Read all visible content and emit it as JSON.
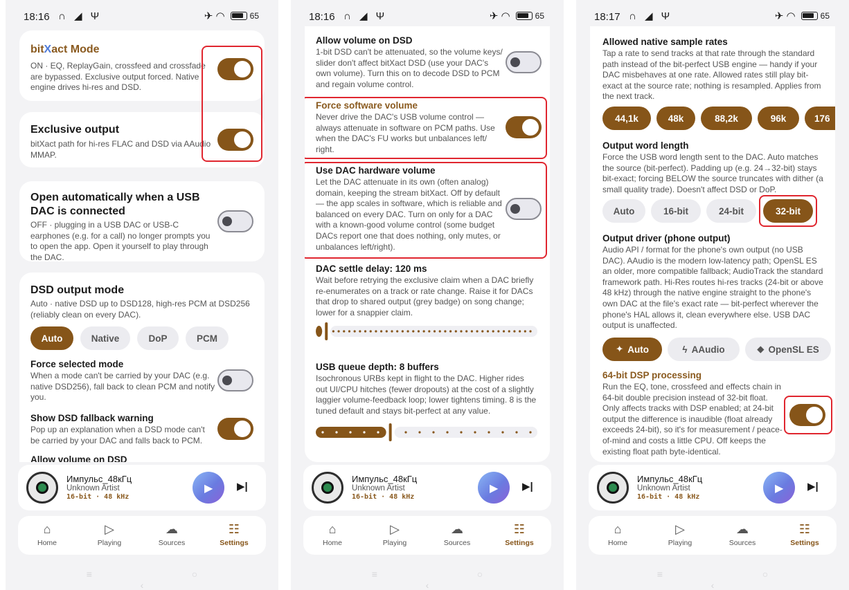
{
  "panel1": {
    "status": {
      "time": "18:16",
      "left_glyphs": "∩ ◢ Ψ",
      "right_glyphs": "✈ ◠",
      "battery": "65"
    },
    "bitxact": {
      "title_a": "bit",
      "title_x": "X",
      "title_b": "act Mode",
      "desc": "ON · EQ, ReplayGain, crossfeed and crossfade are bypassed. Exclusive output forced. Native engine drives hi-res and DSD."
    },
    "exclusive": {
      "title": "Exclusive output",
      "desc": "bitXact path for hi-res FLAC and DSD via AAudio MMAP."
    },
    "openauto": {
      "title": "Open automatically when a USB DAC is connected",
      "desc": "OFF · plugging in a USB DAC or USB-C earphones (e.g. for a call) no longer prompts you to open the app. Open it yourself to play through the DAC."
    },
    "dsd": {
      "title": "DSD output mode",
      "desc": "Auto · native DSD up to DSD128, high-res PCM at DSD256 (reliably clean on every DAC).",
      "chips": [
        "Auto",
        "Native",
        "DoP",
        "PCM"
      ],
      "selected": "Auto"
    },
    "force": {
      "title": "Force selected mode",
      "desc": "When a mode can't be carried by your DAC (e.g. native DSD256), fall back to clean PCM and notify you."
    },
    "warn": {
      "title": "Show DSD fallback warning",
      "desc": "Pop up an explanation when a DSD mode can't be carried by your DAC and falls back to PCM."
    },
    "cut": "Allow volume on DSD"
  },
  "panel2": {
    "status": {
      "time": "18:16",
      "left_glyphs": "∩ ◢ Ψ",
      "right_glyphs": "✈ ◠",
      "battery": "65"
    },
    "allowvol": {
      "title": "Allow volume on DSD",
      "desc": "1-bit DSD can't be attenuated, so the volume keys/ slider don't affect bitXact DSD (use your DAC's own volume). Turn this on to decode DSD to PCM and regain volume control."
    },
    "forcesw": {
      "title": "Force software volume",
      "desc": "Never drive the DAC's USB volume control — always attenuate in software on PCM paths. Use when the DAC's FU works but unbalances left/ right."
    },
    "dachw": {
      "title": "Use DAC hardware volume",
      "desc": "Let the DAC attenuate in its own (often analog) domain, keeping the stream bitXact. Off by default — the app scales in software, which is reliable and balanced on every DAC. Turn on only for a DAC with a known-good volume control (some budget DACs report one that does nothing, only mutes, or unbalances left/right)."
    },
    "settle": {
      "title": "DAC settle delay: 120 ms",
      "desc": "Wait before retrying the exclusive claim when a DAC briefly re-enumerates on a track or rate change. Raise it for DACs that drop to shared output (grey badge) on song change; lower for a snappier claim.",
      "value_fraction": 0.03
    },
    "queue": {
      "title": "USB queue depth: 8 buffers",
      "desc": "Isochronous URBs kept in flight to the DAC. Higher rides out UI/CPU hitches (fewer dropouts) at the cost of a slightly laggier volume-feedback loop; lower tightens timing. 8 is the tuned default and stays bit-perfect at any value.",
      "value_fraction": 0.33
    }
  },
  "panel3": {
    "status": {
      "time": "18:17",
      "left_glyphs": "∩ ◢ Ψ",
      "right_glyphs": "✈ ◠",
      "battery": "65"
    },
    "rates": {
      "title": "Allowed native sample rates",
      "desc": "Tap a rate to send tracks at that rate through the standard path instead of the bit-perfect USB engine — handy if your DAC misbehaves at one rate. Allowed rates still play bit-exact at the source rate; nothing is resampled. Applies from the next track.",
      "chips": [
        "44,1k",
        "48k",
        "88,2k",
        "96k",
        "176"
      ]
    },
    "wordlen": {
      "title": "Output word length",
      "desc": "Force the USB word length sent to the DAC. Auto matches the source (bit-perfect). Padding up (e.g. 24→32-bit) stays bit-exact; forcing BELOW the source truncates with dither (a small quality trade). Doesn't affect DSD or DoP.",
      "chips": [
        "Auto",
        "16-bit",
        "24-bit",
        "32-bit"
      ],
      "selected": "32-bit"
    },
    "driver": {
      "title": "Output driver (phone output)",
      "desc": "Audio API / format for the phone's own output (no USB DAC). AAudio is the modern low-latency path; OpenSL ES an older, more compatible fallback; AudioTrack the standard framework path. Hi-Res routes hi-res tracks (24-bit or above 48 kHz) through the native engine straight to the phone's own DAC at the file's exact rate — bit-perfect wherever the phone's HAL allows it, clean everywhere else. USB DAC output is unaffected.",
      "chips": [
        "Auto",
        "AAudio",
        "OpenSL ES"
      ],
      "chip_icons": [
        "✦",
        "ϟ",
        "◆"
      ],
      "selected": "Auto"
    },
    "dsp64": {
      "title": "64-bit DSP processing",
      "desc": "Run the EQ, tone, crossfeed and effects chain in 64-bit double precision instead of 32-bit float. Only affects tracks with DSP enabled; at 24-bit output the difference is inaudible (float already exceeds 24-bit), so it's for measurement / peace-of-mind and costs a little CPU. Off keeps the existing float path byte-identical."
    }
  },
  "player": {
    "title": "Импульс_48кГц",
    "artist": "Unknown Artist",
    "format": "16-bit · 48 kHz",
    "play_icon": "▶",
    "next_icon": "▶|"
  },
  "nav": {
    "home": "Home",
    "playing": "Playing",
    "sources": "Sources",
    "settings": "Settings",
    "home_icon": "⌂",
    "playing_icon": "▷",
    "sources_icon": "☁",
    "settings_icon": "☷"
  },
  "sysnav": "≡ ○ ‹",
  "colors": {
    "accent": "#865519",
    "highlight": "#e0262f",
    "bg": "#f3f3f5"
  }
}
